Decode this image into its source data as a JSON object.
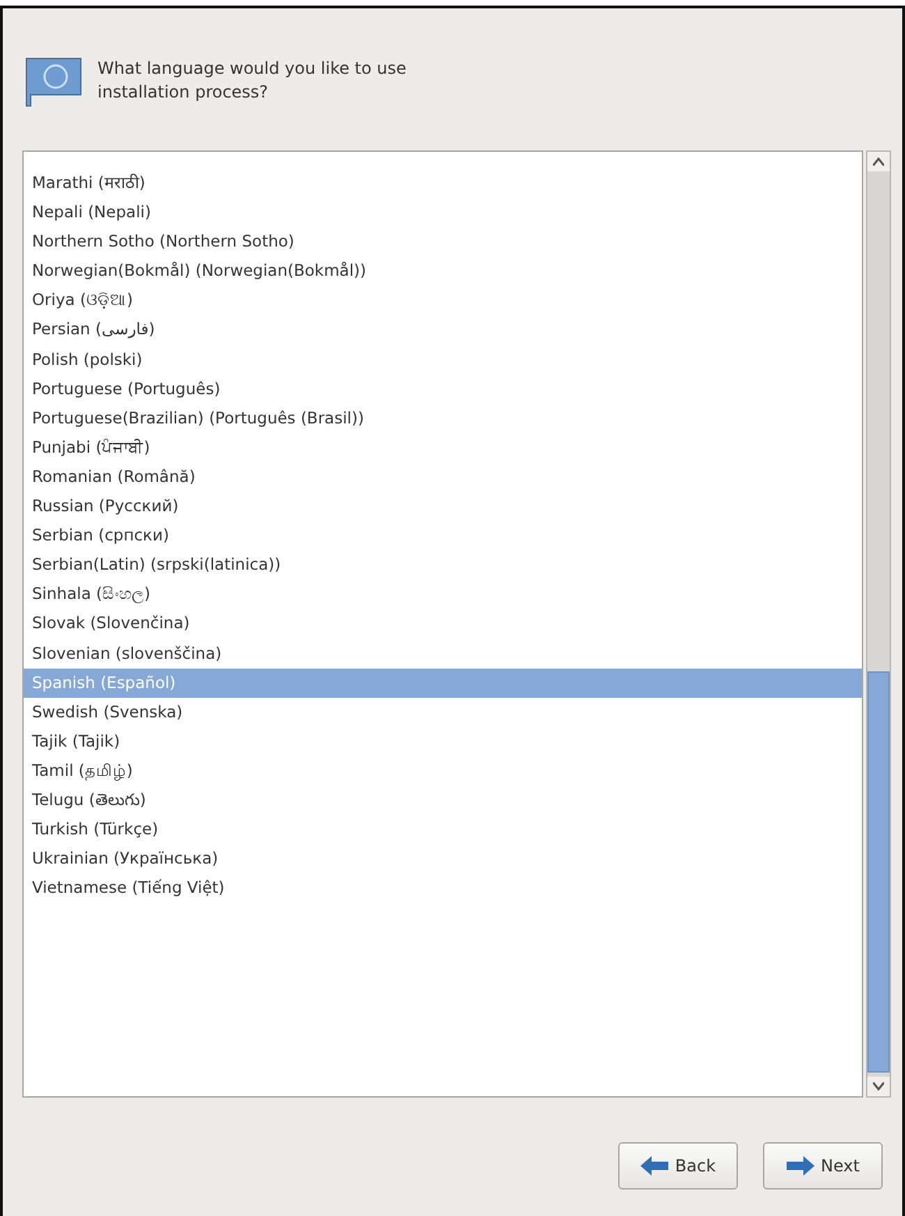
{
  "header": {
    "title": "What language would you like to use\ninstallation process?"
  },
  "languages": [
    {
      "label": "Marathi (मराठी)",
      "selected": false
    },
    {
      "label": "Nepali (Nepali)",
      "selected": false
    },
    {
      "label": "Northern Sotho (Northern Sotho)",
      "selected": false
    },
    {
      "label": "Norwegian(Bokmål) (Norwegian(Bokmål))",
      "selected": false
    },
    {
      "label": "Oriya (ଓଡ଼ିଆ)",
      "selected": false
    },
    {
      "label": "Persian (فارسی)",
      "selected": false
    },
    {
      "label": "Polish (polski)",
      "selected": false
    },
    {
      "label": "Portuguese (Português)",
      "selected": false
    },
    {
      "label": "Portuguese(Brazilian) (Português (Brasil))",
      "selected": false
    },
    {
      "label": "Punjabi (ਪੰਜਾਬੀ)",
      "selected": false
    },
    {
      "label": "Romanian (Română)",
      "selected": false
    },
    {
      "label": "Russian (Русский)",
      "selected": false
    },
    {
      "label": "Serbian (српски)",
      "selected": false
    },
    {
      "label": "Serbian(Latin) (srpski(latinica))",
      "selected": false
    },
    {
      "label": "Sinhala (සිංහල)",
      "selected": false
    },
    {
      "label": "Slovak (Slovenčina)",
      "selected": false
    },
    {
      "label": "Slovenian (slovenščina)",
      "selected": false
    },
    {
      "label": "Spanish (Español)",
      "selected": true
    },
    {
      "label": "Swedish (Svenska)",
      "selected": false
    },
    {
      "label": "Tajik (Tajik)",
      "selected": false
    },
    {
      "label": "Tamil (தமிழ்)",
      "selected": false
    },
    {
      "label": "Telugu (తెలుగు)",
      "selected": false
    },
    {
      "label": "Turkish (Türkçe)",
      "selected": false
    },
    {
      "label": "Ukrainian (Українська)",
      "selected": false
    },
    {
      "label": "Vietnamese (Tiếng Việt)",
      "selected": false
    }
  ],
  "buttons": [
    {
      "label": "Back",
      "kind": "back"
    },
    {
      "label": "Next",
      "kind": "next"
    }
  ]
}
